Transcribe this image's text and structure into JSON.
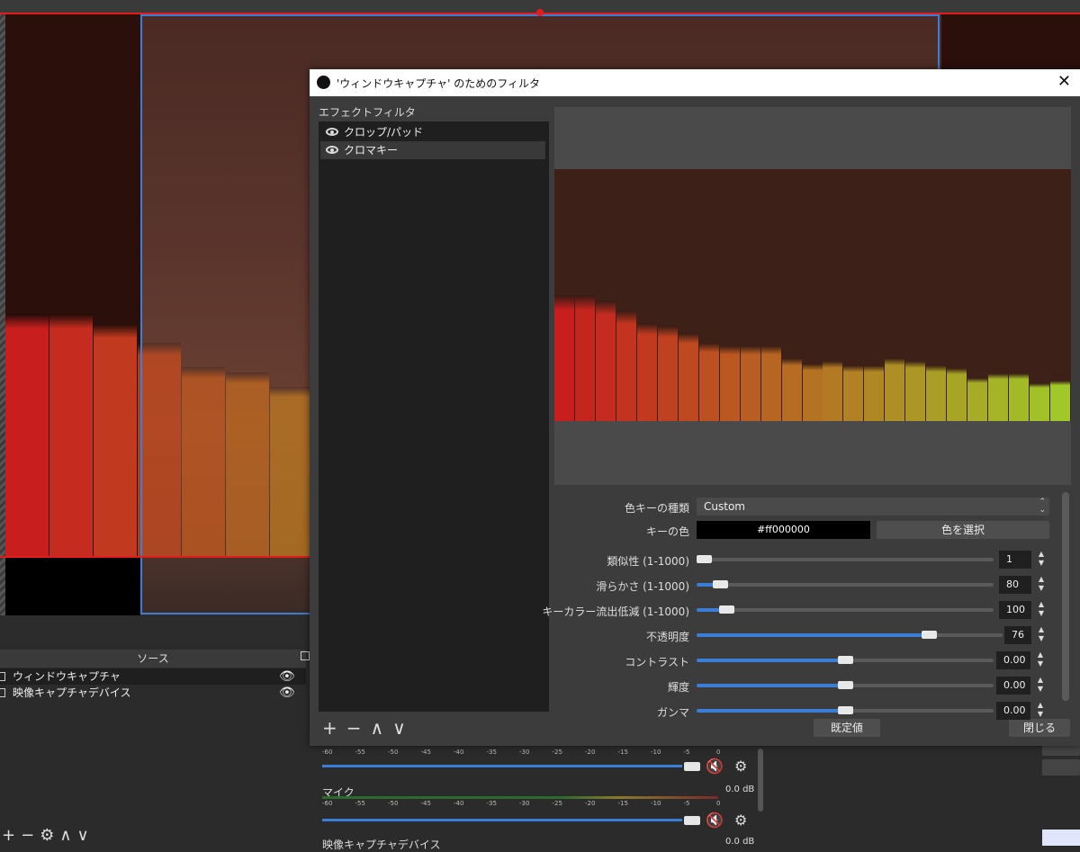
{
  "dialog": {
    "title": "'ウィンドウキャプチャ' のためのフィルタ",
    "close": "✕",
    "effect_filters_label": "エフェクトフィルタ",
    "filters": [
      {
        "label": "クロップ/パッド",
        "selected": false
      },
      {
        "label": "クロマキー",
        "selected": true
      }
    ],
    "toolbar": {
      "add": "+",
      "remove": "−",
      "up": "∧",
      "down": "∨"
    },
    "properties": {
      "key_type_label": "色キーの種類",
      "key_type_value": "Custom",
      "key_color_label": "キーの色",
      "key_color_value": "#ff000000",
      "select_color_button": "色を選択",
      "sliders": [
        {
          "label": "類似性 (1-1000)",
          "value": "1",
          "fraction": 0.0
        },
        {
          "label": "滑らかさ (1-1000)",
          "value": "80",
          "fraction": 0.08
        },
        {
          "label": "キーカラー流出低減 (1-1000)",
          "value": "100",
          "fraction": 0.1
        },
        {
          "label": "不透明度",
          "value": "76",
          "fraction": 0.76
        },
        {
          "label": "コントラスト",
          "value": "0.00",
          "fraction": 0.5
        },
        {
          "label": "輝度",
          "value": "0.00",
          "fraction": 0.5
        },
        {
          "label": "ガンマ",
          "value": "0.00",
          "fraction": 0.5
        }
      ]
    },
    "defaults_button": "既定値",
    "close_button": "閉じる"
  },
  "sources": {
    "header": "ソース",
    "items": [
      {
        "label": "ウィンドウキャプチャ"
      },
      {
        "label": "映像キャプチャデバイス"
      }
    ],
    "toolbar": {
      "add": "+",
      "remove": "−",
      "gear": "⚙",
      "up": "∧",
      "down": "∨"
    }
  },
  "mixer": {
    "ticks": [
      "-60",
      "-55",
      "-50",
      "-45",
      "-40",
      "-35",
      "-30",
      "-25",
      "-20",
      "-15",
      "-10",
      "-5",
      "0"
    ],
    "channels": [
      {
        "name": "マイク",
        "db": "0.0 dB"
      },
      {
        "name": "映像キャプチャデバイス",
        "db": "0.0 dB"
      }
    ]
  },
  "preview_bars": [
    0.5,
    0.5,
    0.48,
    0.44,
    0.39,
    0.38,
    0.35,
    0.31,
    0.3,
    0.3,
    0.3,
    0.25,
    0.23,
    0.24,
    0.22,
    0.22,
    0.25,
    0.24,
    0.22,
    0.21,
    0.17,
    0.19,
    0.19,
    0.15,
    0.16
  ],
  "colors": {
    "accent": "#3b7ed8",
    "key_red": "#e21b1b"
  }
}
